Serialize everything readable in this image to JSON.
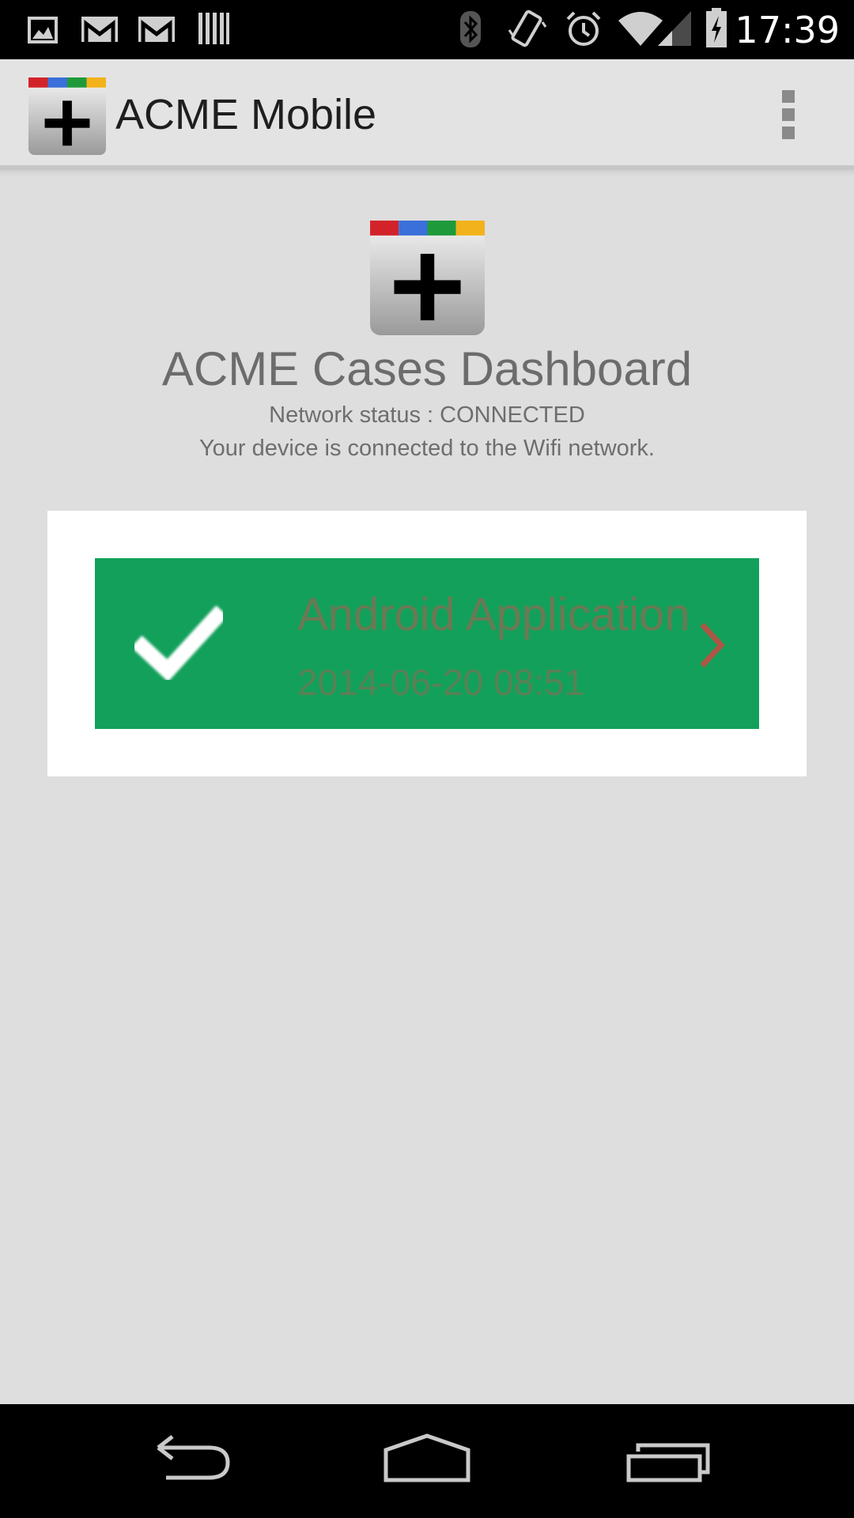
{
  "status_bar": {
    "time": "17:39",
    "left_icons": [
      "gallery-icon",
      "gmail-icon",
      "gmail-icon",
      "barcode-icon"
    ],
    "right_icons": [
      "bluetooth-icon",
      "vibrate-icon",
      "alarm-icon",
      "wifi-icon",
      "signal-icon",
      "battery-charging-icon"
    ]
  },
  "action_bar": {
    "title": "ACME Mobile",
    "menu_icon": "overflow-menu-icon"
  },
  "header": {
    "title": "ACME Cases Dashboard",
    "network_status": "Network status : CONNECTED",
    "network_description": "Your device is connected to the Wifi network."
  },
  "cases": [
    {
      "title": "Android Application",
      "date": "2014-06-20 08:51",
      "status_icon": "checkmark-icon",
      "status_color": "#13a05b"
    }
  ],
  "colors": {
    "accent_green": "#13a05b",
    "logo_stripe": [
      "#d3232a",
      "#3b6fd9",
      "#1f9a3b",
      "#f2b21b"
    ]
  },
  "nav_bar": {
    "icons": [
      "back-icon",
      "home-icon",
      "recents-icon"
    ]
  }
}
